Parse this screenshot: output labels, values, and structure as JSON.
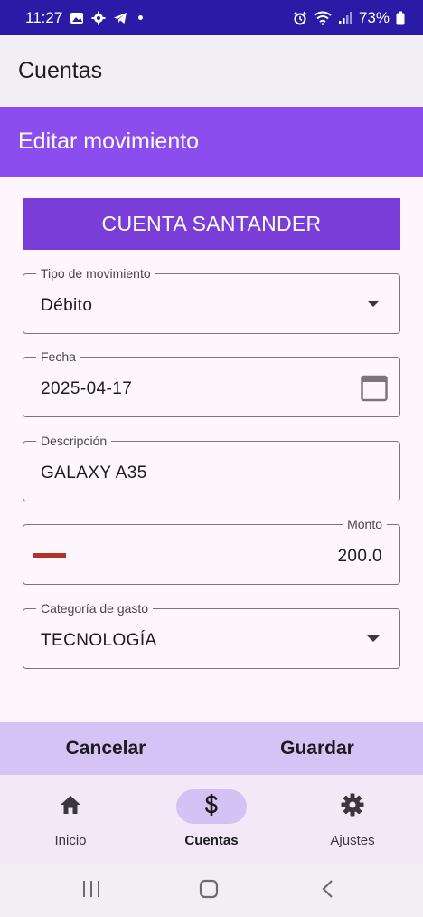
{
  "status_bar": {
    "time": "11:27",
    "battery": "73%",
    "left_icons": [
      "image-icon",
      "settings-gear-icon",
      "telegram-icon",
      "dot-icon"
    ],
    "right_icons": [
      "alarm-icon",
      "wifi-icon",
      "signal-icon",
      "battery-icon"
    ]
  },
  "app_bar": {
    "title": "Cuentas"
  },
  "sub_bar": {
    "title": "Editar movimiento"
  },
  "account": {
    "name": "CUENTA SANTANDER"
  },
  "form": {
    "tipo": {
      "label": "Tipo de movimiento",
      "value": "Débito"
    },
    "fecha": {
      "label": "Fecha",
      "value": "2025-04-17"
    },
    "descripcion": {
      "label": "Descripción",
      "value": "GALAXY A35"
    },
    "monto": {
      "label": "Monto",
      "value": "200.0"
    },
    "categoria": {
      "label": "Categoría de gasto",
      "value": "TECNOLOGÍA"
    }
  },
  "actions": {
    "cancel": "Cancelar",
    "save": "Guardar"
  },
  "nav": {
    "items": [
      {
        "label": "Inicio",
        "icon": "home-icon",
        "active": false
      },
      {
        "label": "Cuentas",
        "icon": "dollar-icon",
        "active": true
      },
      {
        "label": "Ajustes",
        "icon": "gear-icon",
        "active": false
      }
    ]
  },
  "colors": {
    "status_bar": "#2a1aa6",
    "app_bar": "#f1eff4",
    "sub_bar": "#8b4dee",
    "account_banner": "#7a3dd8",
    "minus": "#b3332b",
    "action_bar": "#d7c2f5",
    "nav_bar": "#f2e8f8",
    "nav_active_pill": "#d6c1f4"
  }
}
